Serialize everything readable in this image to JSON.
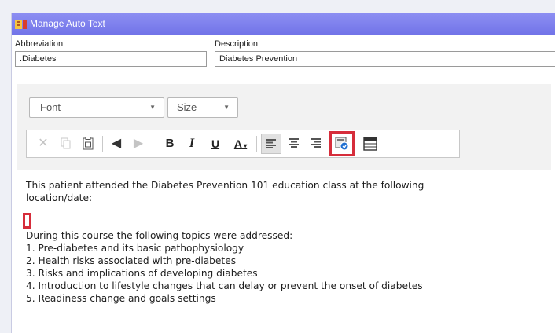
{
  "window": {
    "title": "Manage Auto Text"
  },
  "fields": {
    "abbreviation_label": "Abbreviation",
    "abbreviation_value": ".Diabetes",
    "description_label": "Description",
    "description_value": "Diabetes Prevention"
  },
  "toolbar": {
    "font_label": "Font",
    "size_label": "Size",
    "bold": "B",
    "italic": "I",
    "underline": "U",
    "font_color": "A"
  },
  "editor": {
    "intro_1": "This patient attended the Diabetes Prevention 101 education class at the following",
    "intro_2": "location/date:",
    "course_heading": "During this course the following topics were addressed:",
    "topics": [
      "1. Pre-diabetes and its basic pathophysiology",
      "2. Health risks associated with pre-diabetes",
      "3. Risks and implications of developing diabetes",
      "4. Introduction to lifestyle changes that can delay or prevent the onset of diabetes",
      "5. Readiness change and goals settings"
    ]
  },
  "colors": {
    "titlebar": "#7b7df0",
    "highlight": "#d62d3b",
    "accent": "#1f6fd1"
  },
  "icons": [
    "app-icon",
    "cut-icon",
    "copy-icon",
    "paste-icon",
    "undo-icon",
    "redo-icon",
    "bold-icon",
    "italic-icon",
    "underline-icon",
    "font-color-icon",
    "align-left-icon",
    "align-center-icon",
    "align-right-icon",
    "insert-field-icon",
    "table-icon"
  ]
}
